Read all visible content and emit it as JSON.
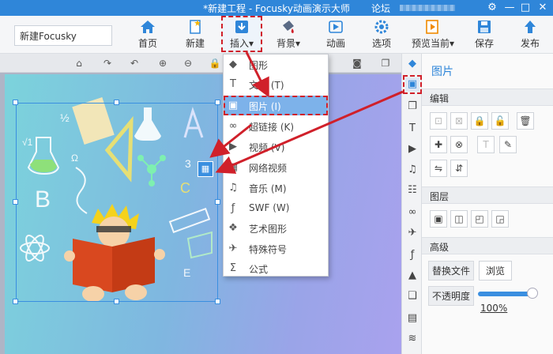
{
  "window": {
    "title": "*新建工程 - Focusky动画演示大师",
    "forum": "论坛",
    "controls": [
      "⚙",
      "—",
      "□",
      "✕"
    ]
  },
  "ribbon": {
    "doc_name": "新建Focusky",
    "buttons": [
      {
        "label": "首页",
        "icon": "home-icon"
      },
      {
        "label": "新建",
        "icon": "new-file-icon"
      },
      {
        "label": "插入",
        "icon": "insert-icon",
        "caret": "▾"
      },
      {
        "label": "背景",
        "icon": "background-paint-icon",
        "caret": "▾"
      },
      {
        "label": "动画",
        "icon": "animation-icon"
      },
      {
        "label": "选项",
        "icon": "options-gear-icon"
      },
      {
        "label": "预览当前",
        "icon": "preview-icon",
        "caret": "▾"
      },
      {
        "label": "保存",
        "icon": "save-icon"
      },
      {
        "label": "发布",
        "icon": "publish-icon"
      }
    ]
  },
  "insert_menu": {
    "items": [
      {
        "label": "图形",
        "icon": "shape-icon"
      },
      {
        "label": "文字 (T)",
        "icon": "text-icon"
      },
      {
        "label": "图片 (I)",
        "icon": "image-icon",
        "active": true
      },
      {
        "label": "超链接 (K)",
        "icon": "link-icon"
      },
      {
        "label": "视频 (V)",
        "icon": "video-icon"
      },
      {
        "label": "网络视频",
        "icon": "web-video-icon"
      },
      {
        "label": "音乐 (M)",
        "icon": "music-icon"
      },
      {
        "label": "SWF (W)",
        "icon": "swf-icon"
      },
      {
        "label": "艺术图形",
        "icon": "art-shape-icon"
      },
      {
        "label": "特殊符号",
        "icon": "symbol-icon"
      },
      {
        "label": "公式",
        "icon": "formula-icon"
      }
    ]
  },
  "panel": {
    "title": "图片",
    "sections": {
      "edit": "编辑",
      "layer": "图层",
      "advanced": "高级"
    },
    "replace_label": "替换文件",
    "browse_label": "浏览",
    "opacity_label": "不透明度",
    "opacity_value": "100%",
    "opacity_fraction": 1.0
  },
  "colors": {
    "titlebar": "#2f86d9",
    "highlight": "#7db2ea",
    "annotation_red": "#d0202a"
  }
}
